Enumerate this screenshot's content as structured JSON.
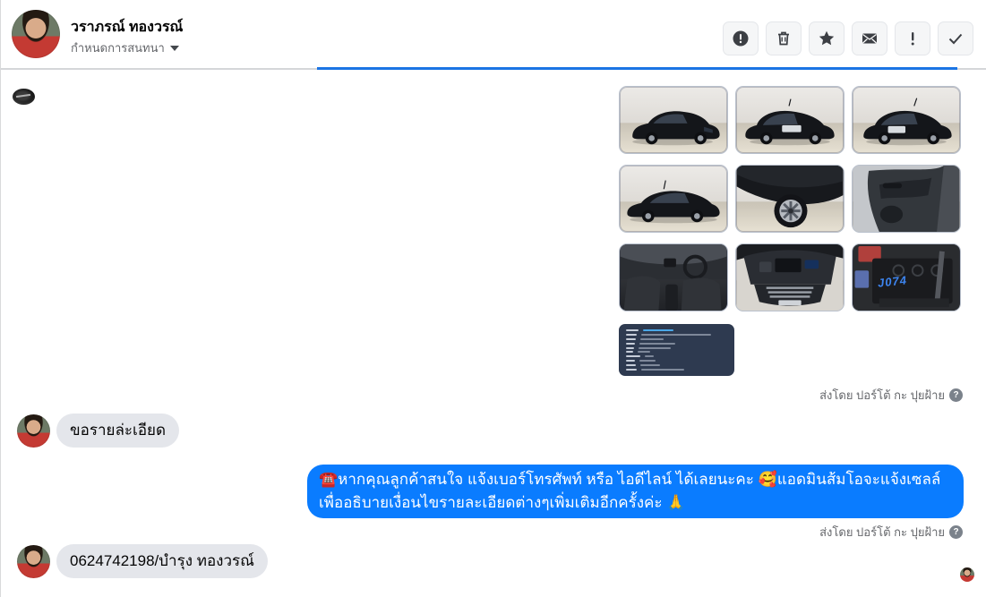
{
  "header": {
    "contact_name": "วราภรณ์ ทองวรณ์",
    "subtitle": "กำหนดการสนทนา",
    "actions": [
      {
        "id": "report",
        "icon": "exclamation-circle-icon"
      },
      {
        "id": "delete",
        "icon": "trash-icon"
      },
      {
        "id": "star",
        "icon": "star-icon"
      },
      {
        "id": "mark-unread",
        "icon": "envelope-icon"
      },
      {
        "id": "mark-important",
        "icon": "exclamation-icon"
      },
      {
        "id": "mark-done",
        "icon": "check-icon"
      }
    ]
  },
  "colors": {
    "accent_blue": "#1b74e4",
    "bubble_blue": "#0a7cff",
    "bubble_gray": "#e4e6eb",
    "muted_text": "#65676b",
    "spec_card_bg": "#2e3a50"
  },
  "conversation": {
    "sent_by_label": "ส่งโดย ปอร์โต้ กะ ปุยฝ้าย",
    "photo_attachment": {
      "count": 9,
      "subject": "black sedan car photos",
      "battery_marking": "J074"
    },
    "messages": [
      {
        "from": "customer",
        "text": "ขอรายล่ะเอียด"
      },
      {
        "from": "page",
        "text": "☎️หากคุณลูกค้าสนใจ แจ้งเบอร์โทรศัพท์ หรือ ไอดีไลน์  ได้เลยนะคะ 🥰แอดมินส้มโอจะแจ้งเซลล์  เพื่ออธิบายเงื่อนไขรายละเอียดต่างๆเพิ่มเติมอีกครั้งค่ะ 🙏"
      },
      {
        "from": "customer",
        "text": "0624742198/บำรุง ทองวรณ์"
      }
    ]
  }
}
